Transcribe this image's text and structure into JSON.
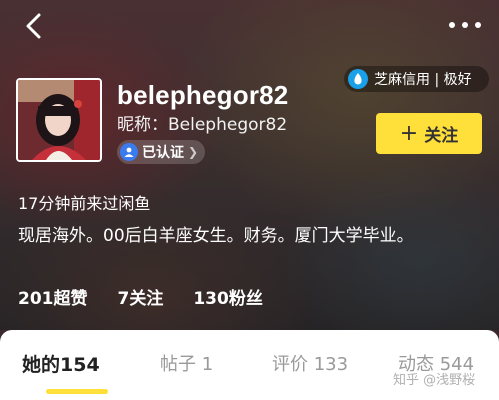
{
  "profile": {
    "username": "belephegor82",
    "nickname_label": "昵称：",
    "nickname": "Belephegor82",
    "verified_label": "已认证",
    "credit_label": "芝麻信用 | 极好",
    "follow_label": "关注",
    "last_seen": "17分钟前来过闲鱼",
    "bio": "现居海外。00后白羊座女生。财务。厦门大学毕业。"
  },
  "stats": [
    {
      "value": "201",
      "label": "超赞"
    },
    {
      "value": "7",
      "label": "关注"
    },
    {
      "value": "130",
      "label": "粉丝"
    }
  ],
  "tabs": [
    {
      "label": "她的",
      "count": "154"
    },
    {
      "label": "帖子",
      "count": "1"
    },
    {
      "label": "评价",
      "count": "133"
    },
    {
      "label": "动态",
      "count": "544"
    }
  ],
  "watermark": "知乎 @浅野桜",
  "colors": {
    "accent": "#ffdf3a",
    "verified": "#3b7bf0",
    "credit": "#1aa0e8"
  }
}
